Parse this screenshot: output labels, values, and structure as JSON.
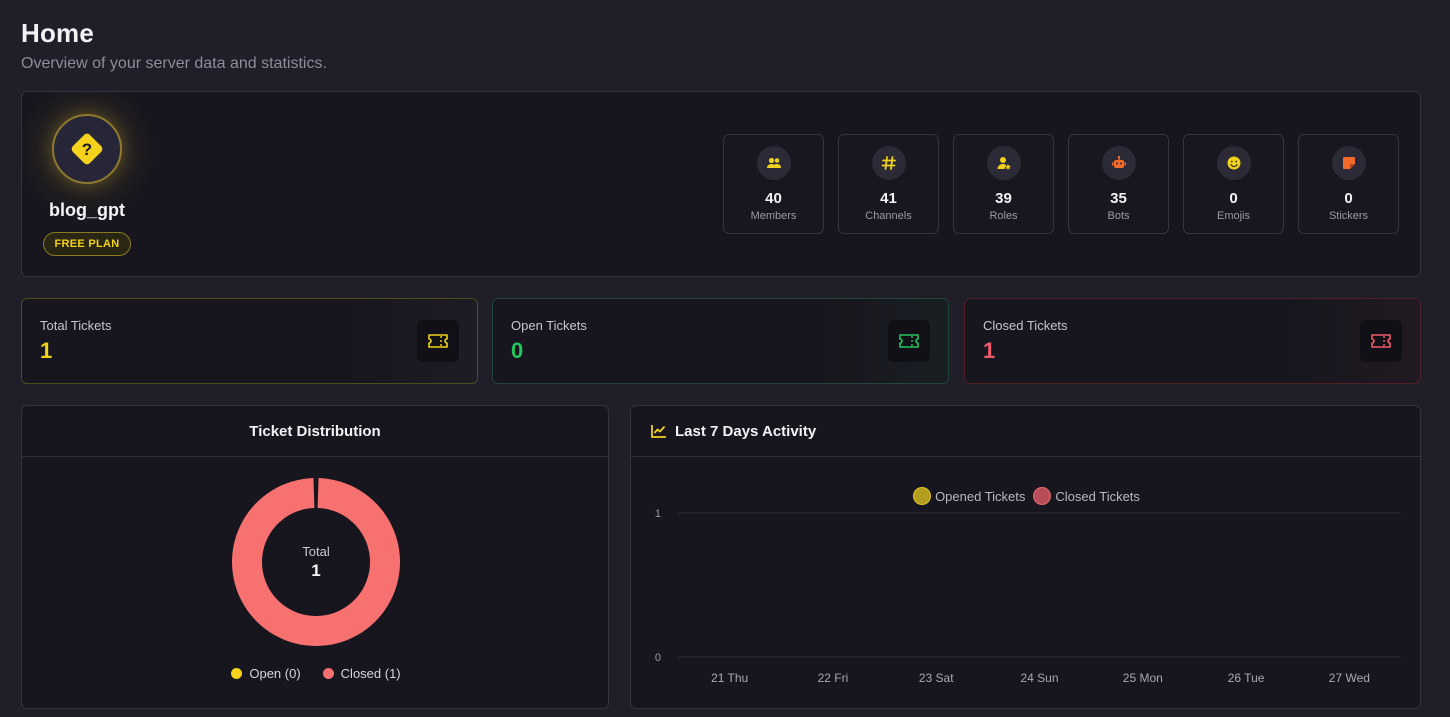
{
  "header": {
    "title": "Home",
    "subtitle": "Overview of your server data and statistics."
  },
  "server": {
    "name": "blog_gpt",
    "plan": "FREE PLAN",
    "avatar_icon": "question-diamond-icon",
    "stats": [
      {
        "value": "40",
        "label": "Members",
        "icon": "members-icon",
        "color": "#f0d21a"
      },
      {
        "value": "41",
        "label": "Channels",
        "icon": "hash-icon",
        "color": "#f0d21a"
      },
      {
        "value": "39",
        "label": "Roles",
        "icon": "user-role-icon",
        "color": "#f0d21a"
      },
      {
        "value": "35",
        "label": "Bots",
        "icon": "robot-icon",
        "color": "#f26b2a"
      },
      {
        "value": "0",
        "label": "Emojis",
        "icon": "smiley-icon",
        "color": "#f0d21a"
      },
      {
        "value": "0",
        "label": "Stickers",
        "icon": "sticker-icon",
        "color": "#f26b2a"
      }
    ]
  },
  "tickets": {
    "total": {
      "label": "Total Tickets",
      "value": "1",
      "color": "#f0d21a"
    },
    "open": {
      "label": "Open Tickets",
      "value": "0",
      "color": "#22c55e"
    },
    "closed": {
      "label": "Closed Tickets",
      "value": "1",
      "color": "#f05b6b"
    }
  },
  "distribution": {
    "title": "Ticket Distribution",
    "center_label": "Total",
    "center_value": "1",
    "legend": [
      {
        "label": "Open (0)",
        "color": "#f5d31c"
      },
      {
        "label": "Closed (1)",
        "color": "#f87171"
      }
    ]
  },
  "activity": {
    "title": "Last 7 Days Activity",
    "icon": "chart-line-icon"
  },
  "chart_data": [
    {
      "type": "pie",
      "categories": [
        "Open",
        "Closed"
      ],
      "values": [
        0,
        1
      ],
      "colors": [
        "#f5d31c",
        "#f87171"
      ],
      "style": "donut"
    },
    {
      "type": "line",
      "categories": [
        "21 Thu",
        "22 Fri",
        "23 Sat",
        "24 Sun",
        "25 Mon",
        "26 Tue",
        "27 Wed"
      ],
      "series": [
        {
          "name": "Opened Tickets",
          "values": [
            0,
            0,
            0,
            0,
            0,
            0,
            0
          ],
          "color": "#c9b21c"
        },
        {
          "name": "Closed Tickets",
          "values": [
            0,
            0,
            0,
            0,
            0,
            0,
            0
          ],
          "color": "#c95a61"
        }
      ],
      "yticks": [
        "1",
        "0"
      ],
      "ylim": [
        0,
        1
      ],
      "grid": true,
      "legend": "top-center"
    }
  ]
}
